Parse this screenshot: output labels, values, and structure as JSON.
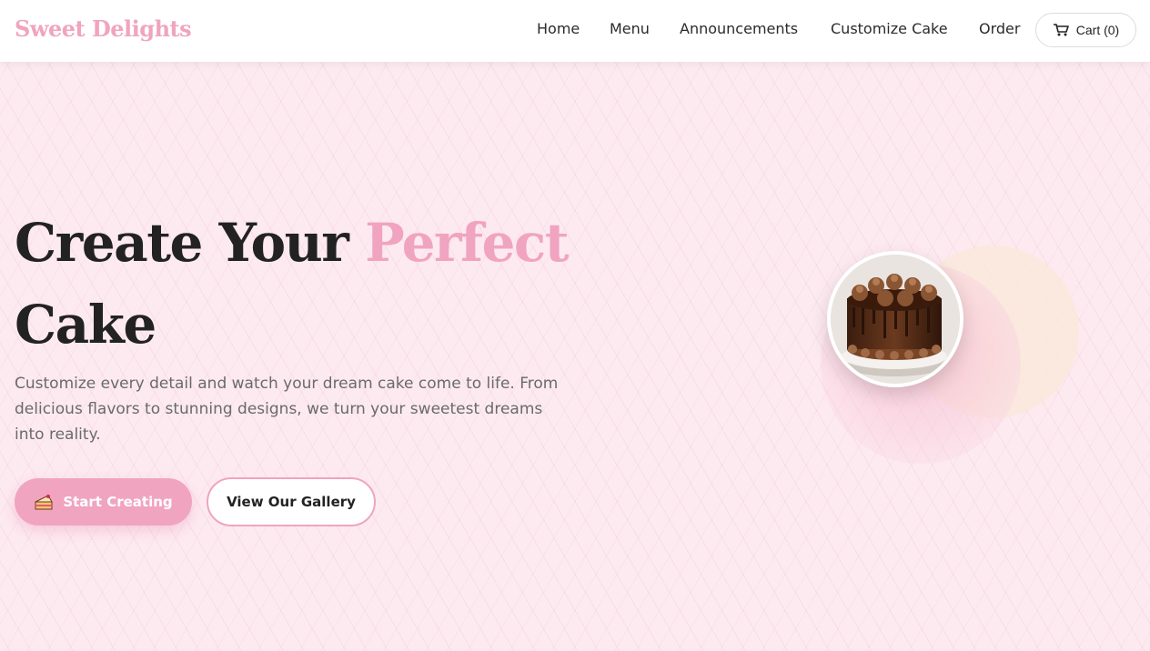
{
  "brand": {
    "name": "Sweet Delights"
  },
  "nav": {
    "links": [
      "Home",
      "Menu",
      "Announcements",
      "Customize Cake",
      "Order"
    ],
    "cart_label": "Cart (0)"
  },
  "hero": {
    "title_part1": "Create Your ",
    "title_accent": "Perfect",
    "title_part2": "Cake",
    "description": "Customize every detail and watch your dream cake come to life. From delicious flavors to stunning designs, we turn your sweetest dreams into reality.",
    "primary_button": "Start Creating",
    "secondary_button": "View Our Gallery"
  },
  "colors": {
    "accent": "#f0a4bf",
    "background": "#fdeaf0",
    "text_dark": "#222222",
    "text_muted": "#6a6a6a"
  },
  "icons": {
    "cart": "cart-icon",
    "button": "cake-slice-icon",
    "hero_image": "chocolate-cake-image"
  }
}
